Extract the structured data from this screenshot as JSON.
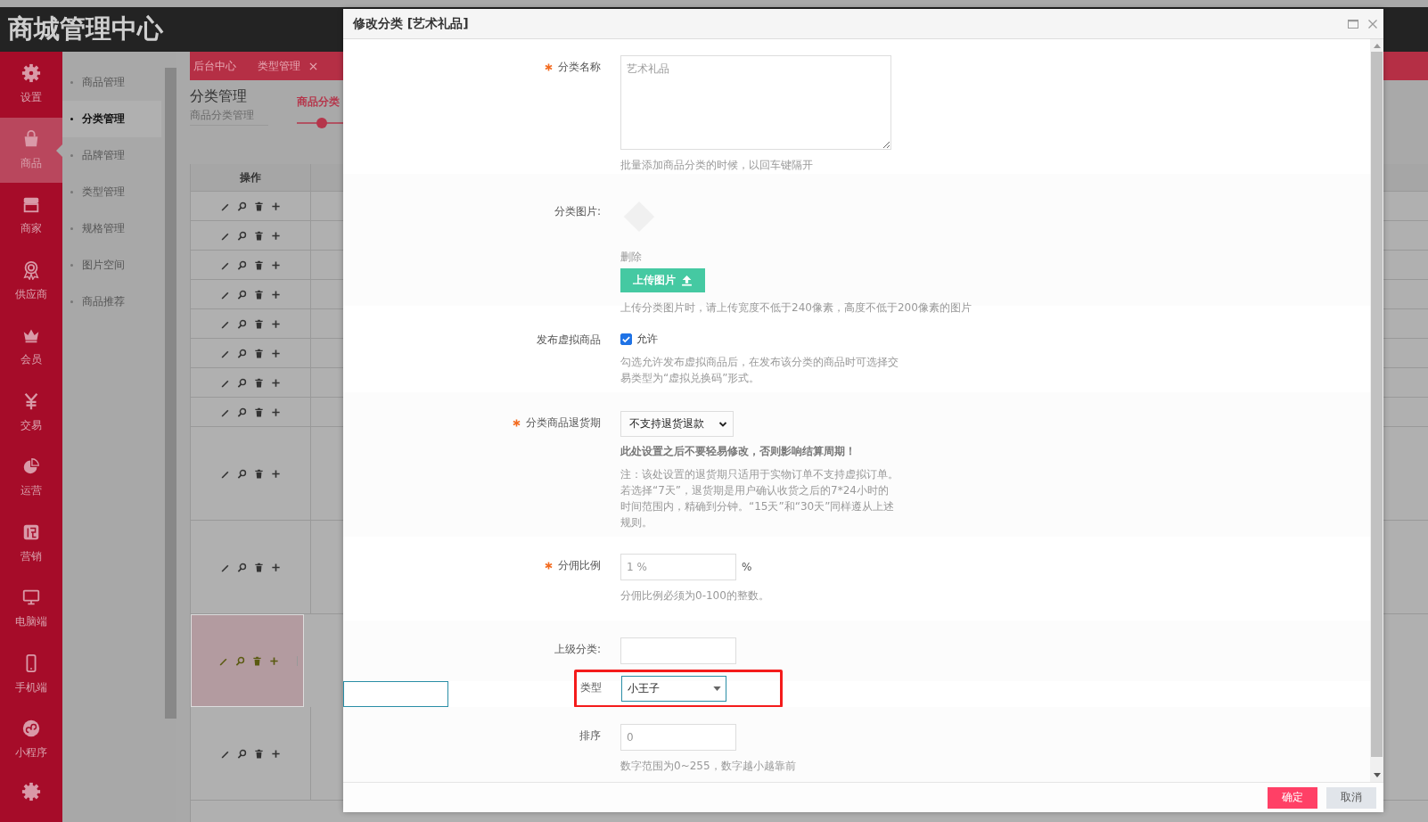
{
  "header": {
    "title": "商城管理中心"
  },
  "nav": [
    {
      "label": "设置",
      "selected": false
    },
    {
      "label": "商品",
      "selected": true
    },
    {
      "label": "商家",
      "selected": false
    },
    {
      "label": "供应商",
      "selected": false
    },
    {
      "label": "会员",
      "selected": false
    },
    {
      "label": "交易",
      "selected": false
    },
    {
      "label": "运营",
      "selected": false
    },
    {
      "label": "营销",
      "selected": false
    },
    {
      "label": "电脑端",
      "selected": false
    },
    {
      "label": "手机端",
      "selected": false
    },
    {
      "label": "小程序",
      "selected": false
    }
  ],
  "submenu": [
    {
      "label": "商品管理",
      "selected": false
    },
    {
      "label": "分类管理",
      "selected": true
    },
    {
      "label": "品牌管理",
      "selected": false
    },
    {
      "label": "类型管理",
      "selected": false
    },
    {
      "label": "规格管理",
      "selected": false
    },
    {
      "label": "图片空间",
      "selected": false
    },
    {
      "label": "商品推荐",
      "selected": false
    }
  ],
  "tabs": [
    {
      "label": "后台中心",
      "closable": false
    },
    {
      "label": "类型管理",
      "closable": true
    }
  ],
  "page": {
    "title": "分类管理",
    "subtitle": "商品分类管理",
    "step": "商品分类"
  },
  "table": {
    "columns": [
      "操作"
    ],
    "rows": [
      {
        "kind": "short",
        "selected": false
      },
      {
        "kind": "short",
        "selected": false
      },
      {
        "kind": "short",
        "selected": false
      },
      {
        "kind": "short",
        "selected": false
      },
      {
        "kind": "short",
        "selected": false
      },
      {
        "kind": "short",
        "selected": false
      },
      {
        "kind": "short",
        "selected": false
      },
      {
        "kind": "short",
        "selected": false
      },
      {
        "kind": "tall",
        "selected": false
      },
      {
        "kind": "tall",
        "selected": false
      },
      {
        "kind": "tall",
        "selected": true
      },
      {
        "kind": "tall",
        "selected": false
      }
    ]
  },
  "modal": {
    "title": "修改分类 [艺术礼品]",
    "fields": [
      {
        "kind": "textarea",
        "required": true,
        "label": "分类名称",
        "placeholder": "艺术礼品",
        "hint": "批量添加商品分类的时候，以回车键隔开"
      },
      {
        "kind": "image",
        "required": false,
        "label": "分类图片:",
        "delete": "删除",
        "button": "上传图片",
        "hint": "上传分类图片时，请上传宽度不低于240像素，高度不低于200像素的图片"
      },
      {
        "kind": "checkbox",
        "required": false,
        "label": "发布虚拟商品",
        "option": "允许",
        "checked": true,
        "hint": "勾选允许发布虚拟商品后，在发布该分类的商品时可选择交易类型为“虚拟兑换码”形式。"
      },
      {
        "kind": "select",
        "required": true,
        "label": "分类商品退货期",
        "value": "不支持退货退款",
        "warning": "此处设置之后不要轻易修改，否则影响结算周期！",
        "hint": "注：该处设置的退货期只适用于实物订单不支持虚拟订单。若选择“7天”，退货期是用户确认收货之后的7*24小时的时间范围内，精确到分钟。“15天”和“30天”同样遵从上述规则。"
      },
      {
        "kind": "text",
        "required": true,
        "label": "分佣比例",
        "placeholder": "1 %",
        "suffix": "%",
        "hint": "分佣比例必须为0-100的整数。"
      },
      {
        "kind": "text",
        "required": false,
        "label": "上级分类:"
      },
      {
        "kind": "combo",
        "required": false,
        "label": "类型",
        "value": "小王子",
        "highlighted": true
      },
      {
        "kind": "text",
        "required": false,
        "label": "排序",
        "placeholder": "0",
        "hint": "数字范围为0~255，数字越小越靠前"
      }
    ],
    "buttons": [
      {
        "label": "确定",
        "kind": "primary"
      },
      {
        "label": "取消",
        "kind": "secondary"
      }
    ]
  }
}
